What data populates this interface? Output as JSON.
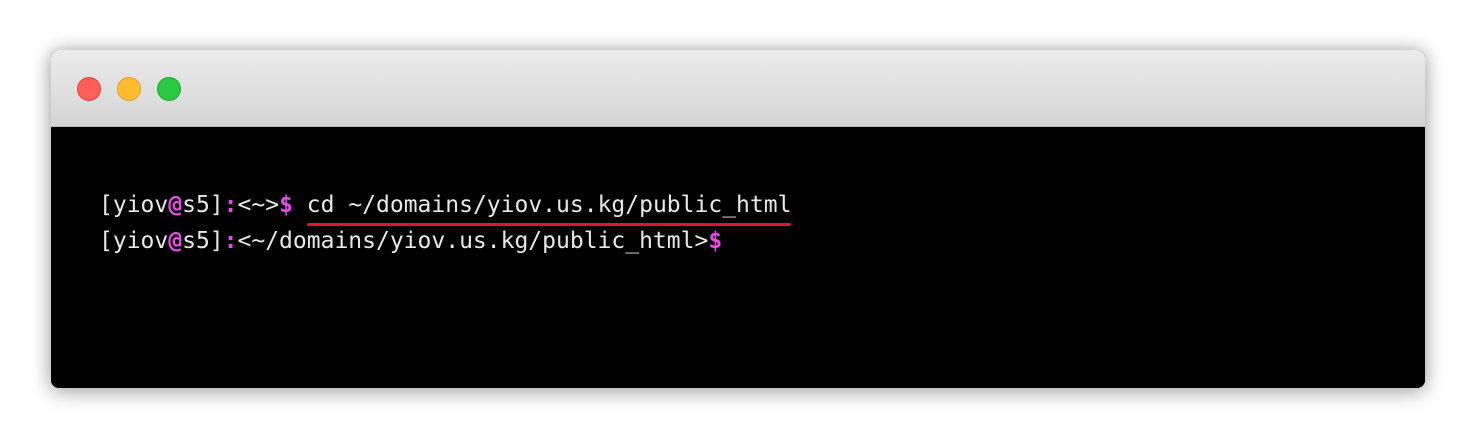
{
  "colors": {
    "close": "#ff5f57",
    "minimize": "#febc2e",
    "zoom": "#28c840",
    "prompt_accent": "#e84be8",
    "text": "#e8e8e8",
    "terminal_bg": "#000000",
    "highlight_underline": "#e8102a"
  },
  "titlebar": {
    "buttons": [
      "close-button",
      "minimize-button",
      "zoom-button"
    ]
  },
  "terminal": {
    "lines": [
      {
        "user_open": "[yiov",
        "at": "@",
        "host_close": "s5]",
        "colon": ":",
        "path": "<~>",
        "dollar": "$",
        "command": "cd ~/domains/yiov.us.kg/public_html"
      },
      {
        "user_open": "[yiov",
        "at": "@",
        "host_close": "s5]",
        "colon": ":",
        "path": "<~/domains/yiov.us.kg/public_html>",
        "dollar": "$"
      }
    ]
  }
}
